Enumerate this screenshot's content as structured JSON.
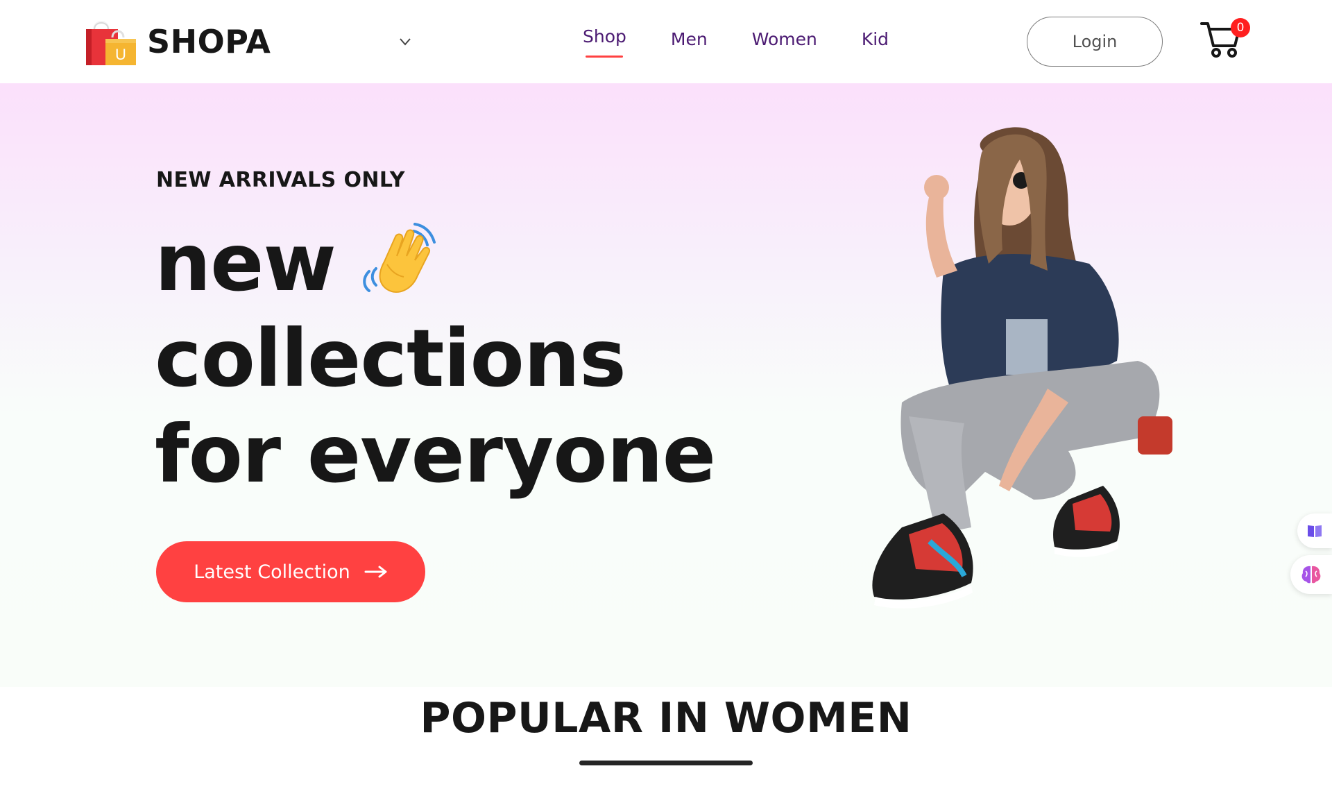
{
  "navbar": {
    "brand": "SHOPA",
    "logo_icon": "shopping-bags-icon",
    "dropdown_icon": "chevron-down-icon",
    "menu": [
      {
        "label": "Shop",
        "active": true
      },
      {
        "label": "Men",
        "active": false
      },
      {
        "label": "Women",
        "active": false
      },
      {
        "label": "Kid",
        "active": false
      }
    ],
    "login_label": "Login",
    "cart_icon": "cart-icon",
    "cart_count": "0"
  },
  "hero": {
    "eyebrow": "NEW ARRIVALS ONLY",
    "title_lines": [
      "new",
      "collections",
      "for everyone"
    ],
    "wave_icon": "waving-hand-icon",
    "cta_label": "Latest Collection",
    "cta_icon": "arrow-right-icon",
    "model_image": "model-photo"
  },
  "side_widgets": [
    {
      "icon": "book-icon"
    },
    {
      "icon": "brain-icon"
    }
  ],
  "popular": {
    "title": "POPULAR IN WOMEN"
  },
  "colors": {
    "accent": "#ff4141",
    "nav_text": "#4b1a72",
    "text_dark": "#171717",
    "hero_gradient_top": "#fbe0fb",
    "hero_gradient_bottom": "#f9fdf9"
  }
}
